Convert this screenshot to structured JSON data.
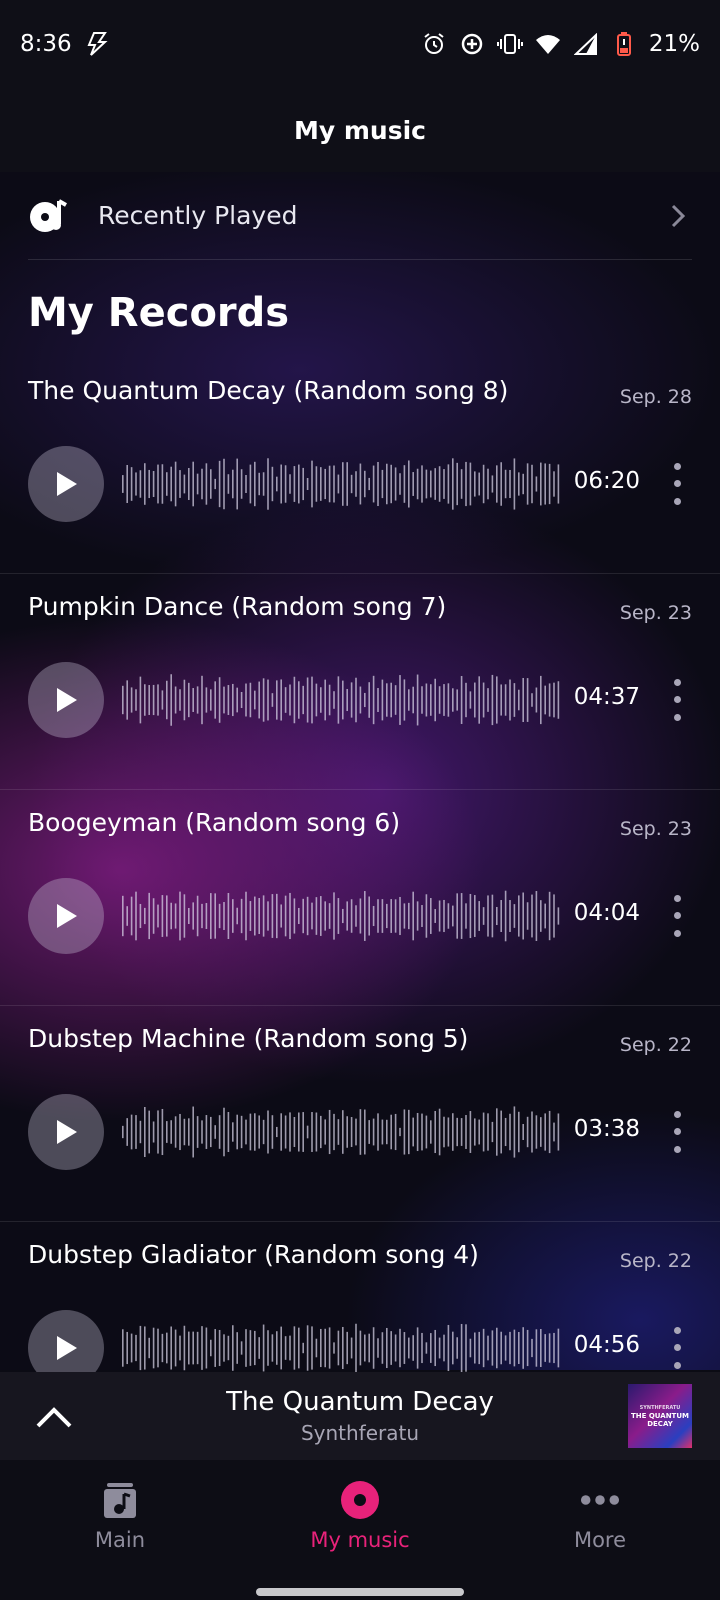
{
  "status_bar": {
    "time": "8:36",
    "battery": "21%",
    "icons": [
      "flash-icon",
      "alarm-icon",
      "data-saver-icon",
      "vibrate-icon",
      "wifi-icon",
      "signal-icon",
      "battery-icon"
    ]
  },
  "header": {
    "title": "My music"
  },
  "recently_played": {
    "label": "Recently Played"
  },
  "section": {
    "title": "My Records"
  },
  "songs": [
    {
      "title": "The Quantum Decay (Random song 8)",
      "date": "Sep. 28",
      "duration": "06:20"
    },
    {
      "title": "Pumpkin Dance (Random song 7)",
      "date": "Sep. 23",
      "duration": "04:37"
    },
    {
      "title": "Boogeyman (Random song 6)",
      "date": "Sep. 23",
      "duration": "04:04"
    },
    {
      "title": "Dubstep Machine (Random song 5)",
      "date": "Sep. 22",
      "duration": "03:38"
    },
    {
      "title": "Dubstep Gladiator (Random song 4)",
      "date": "Sep. 22",
      "duration": "04:56"
    }
  ],
  "now_playing": {
    "title": "The Quantum Decay",
    "artist": "Synthferatu",
    "album_art_text": "THE QUANTUM DECAY",
    "album_art_small_text": "SYNTHFERATU"
  },
  "bottom_nav": [
    {
      "label": "Main",
      "icon": "music-note-icon",
      "active": false
    },
    {
      "label": "My music",
      "icon": "record-icon",
      "active": true
    },
    {
      "label": "More",
      "icon": "more-dots-icon",
      "active": false
    }
  ],
  "colors": {
    "accent": "#e8227a",
    "background": "#0c0b16"
  }
}
